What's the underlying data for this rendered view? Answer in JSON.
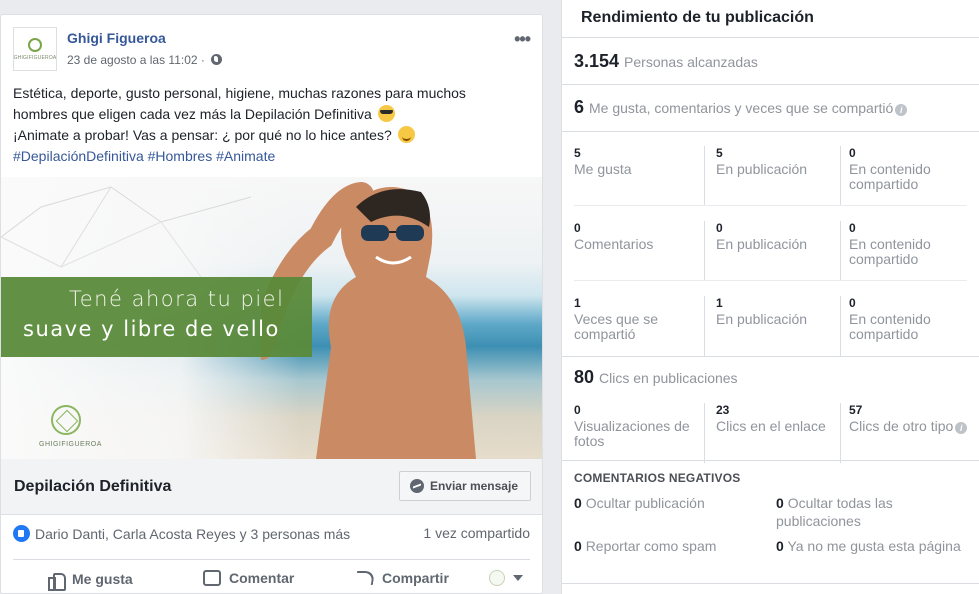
{
  "post": {
    "page_name": "Ghigi Figueroa",
    "avatar_text": "GHIGIFIGUEROA",
    "timestamp": "23 de agosto a las 11:02 ·",
    "text_line1": "Estética, deporte, gusto personal, higiene, muchas razones para muchos",
    "text_line2": "hombres que eligen cada vez más la Depilación Definitiva",
    "text_line3": "¡Animate a probar! Vas a pensar: ¿ por qué no lo hice antes?",
    "hashtags": "#DepilaciónDefinitiva #Hombres #Animate",
    "image": {
      "banner_line1": "Tené ahora tu piel",
      "banner_line2": "suave y libre de vello",
      "logo_text": "GHIGIFIGUEROA",
      "banner_color": "#5a8a3a"
    },
    "cta_title": "Depilación Definitiva",
    "cta_button": "Enviar mensaje",
    "reactions_text": "Dario Danti, Carla Acosta Reyes y 3 personas más",
    "shares_text": "1 vez compartido",
    "actions": {
      "like": "Me gusta",
      "comment": "Comentar",
      "share": "Compartir"
    }
  },
  "panel": {
    "title": "Rendimiento de tu publicación",
    "reach": {
      "value": "3.154",
      "label": "Personas alcanzadas"
    },
    "engagement": {
      "value": "6",
      "label": "Me gusta, comentarios y veces que se compartió"
    },
    "rows": [
      {
        "c1": {
          "num": "5",
          "label": "Me gusta"
        },
        "c2": {
          "num": "5",
          "label": "En publicación"
        },
        "c3": {
          "num": "0",
          "label": "En contenido compartido"
        }
      },
      {
        "c1": {
          "num": "0",
          "label": "Comentarios"
        },
        "c2": {
          "num": "0",
          "label": "En publicación"
        },
        "c3": {
          "num": "0",
          "label": "En contenido compartido"
        }
      },
      {
        "c1": {
          "num": "1",
          "label": "Veces que se compartió"
        },
        "c2": {
          "num": "1",
          "label": "En publicación"
        },
        "c3": {
          "num": "0",
          "label": "En contenido compartido"
        }
      }
    ],
    "clicks": {
      "value": "80",
      "label": "Clics en publicaciones"
    },
    "click_row": {
      "c1": {
        "num": "0",
        "label": "Visualizaciones de fotos"
      },
      "c2": {
        "num": "23",
        "label": "Clics en el enlace"
      },
      "c3": {
        "num": "57",
        "label": "Clics de otro tipo"
      }
    },
    "negative": {
      "title": "COMENTARIOS NEGATIVOS",
      "hide_post": {
        "num": "0",
        "label": "Ocultar publicación"
      },
      "hide_all": {
        "num": "0",
        "label": "Ocultar todas las publicaciones"
      },
      "spam": {
        "num": "0",
        "label": "Reportar como spam"
      },
      "unlike": {
        "num": "0",
        "label": "Ya no me gusta esta página"
      }
    }
  }
}
